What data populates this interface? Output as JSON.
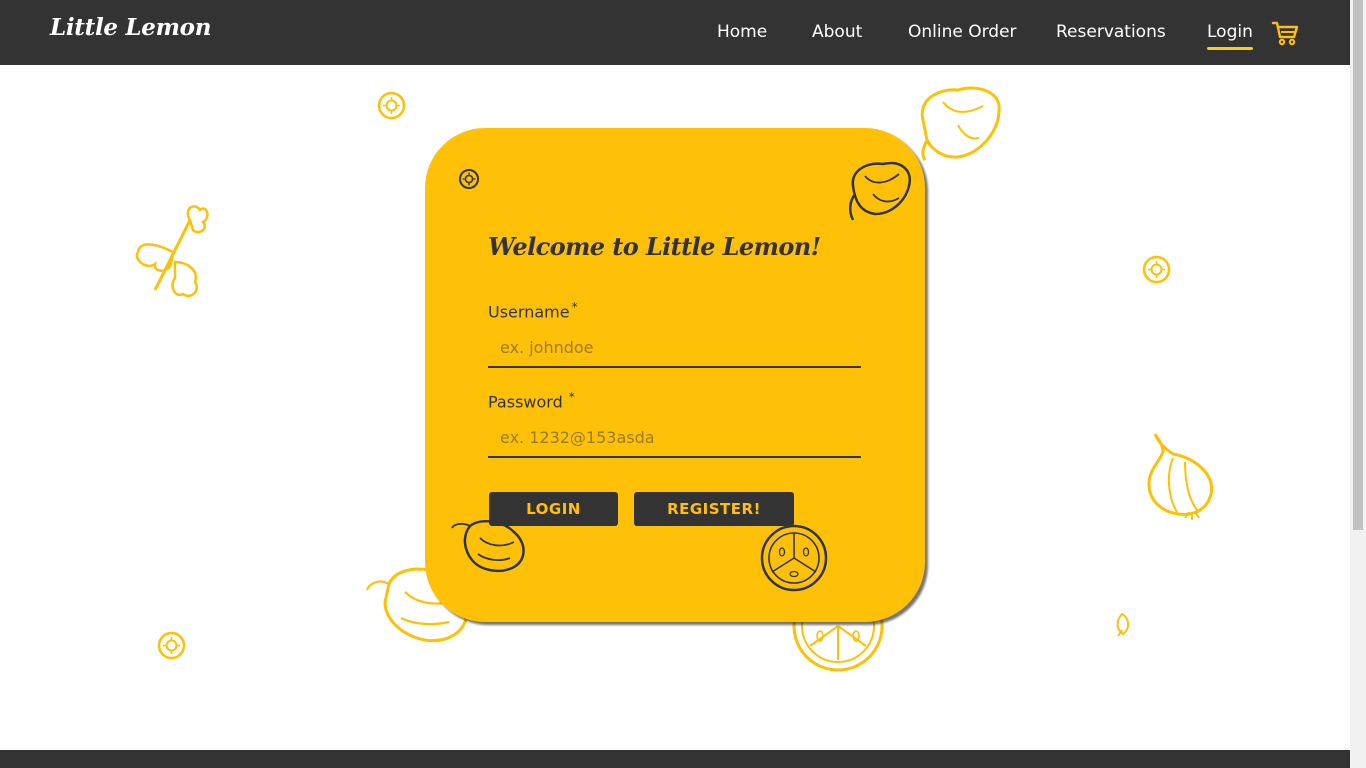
{
  "header": {
    "brand": "Little Lemon",
    "nav": [
      {
        "label": "Home"
      },
      {
        "label": "About"
      },
      {
        "label": "Online Order"
      },
      {
        "label": "Reservations"
      },
      {
        "label": "Login",
        "active": true
      }
    ],
    "cart_icon": "cart-icon"
  },
  "login": {
    "title": "Welcome to Little Lemon!",
    "username_label": "Username",
    "username_required": "*",
    "username_placeholder": "ex. johndoe",
    "password_label": "Password",
    "password_required": "*",
    "password_placeholder": "ex. 1232@153asda",
    "login_button": "LOGIN",
    "register_button": "REGISTER!"
  },
  "colors": {
    "header_bg": "#333333",
    "accent_yellow": "#FFC107",
    "nav_underline": "#F4CE14",
    "dark_text": "#333333"
  },
  "decorations": [
    "lemon-slice-icon",
    "pepper-icon",
    "parsley-icon",
    "garlic-icon",
    "tomato-icon",
    "seed-icon"
  ]
}
